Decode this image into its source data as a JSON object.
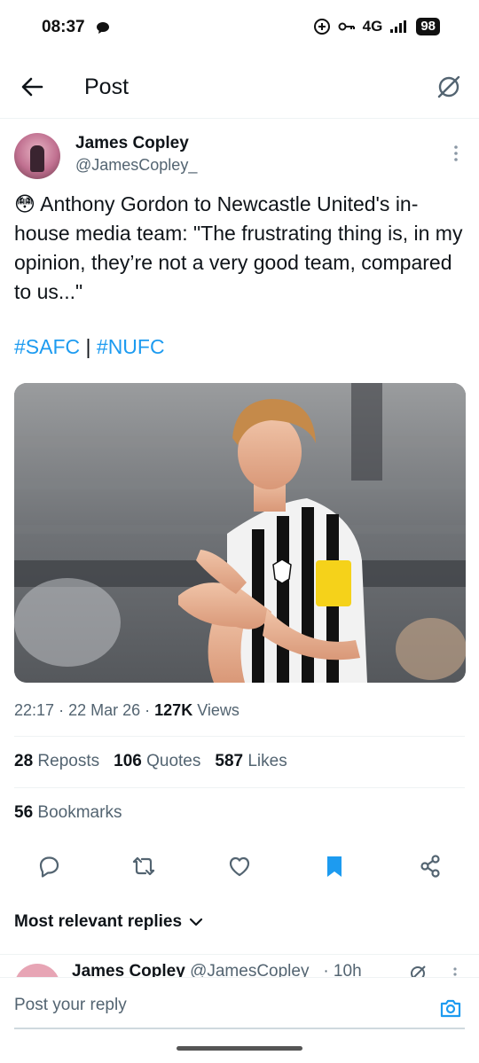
{
  "status_bar": {
    "time": "08:37",
    "network": "4G",
    "battery": "98"
  },
  "header": {
    "title": "Post"
  },
  "author": {
    "name": "James Copley",
    "handle": "@JamesCopley_"
  },
  "tweet": {
    "emoji": "😳",
    "text": "Anthony Gordon to Newcastle United's in-house media team: \"The frustrating thing is, in my opinion, they’re not a very good team, compared to us...\"",
    "hashtag_1": "#SAFC",
    "separator": "|",
    "hashtag_2": "#NUFC"
  },
  "meta": {
    "time": "22:17",
    "dot": "·",
    "date": "22 Mar 26",
    "views_count": "127K",
    "views_label": "Views"
  },
  "stats": {
    "reposts_count": "28",
    "reposts_label": "Reposts",
    "quotes_count": "106",
    "quotes_label": "Quotes",
    "likes_count": "587",
    "likes_label": "Likes",
    "bookmarks_count": "56",
    "bookmarks_label": "Bookmarks"
  },
  "actions": [
    "reply-icon",
    "repost-icon",
    "like-icon",
    "bookmark-icon",
    "share-icon"
  ],
  "colors": {
    "accent": "#1d9bf0",
    "text": "#0f1419",
    "muted": "#536471"
  },
  "replies": {
    "sort_label": "Most relevant replies"
  },
  "next_reply": {
    "name": "James Copley",
    "handle": "@JamesCopley_",
    "age": "· 10h"
  },
  "reply_bar": {
    "placeholder": "Post your reply"
  }
}
